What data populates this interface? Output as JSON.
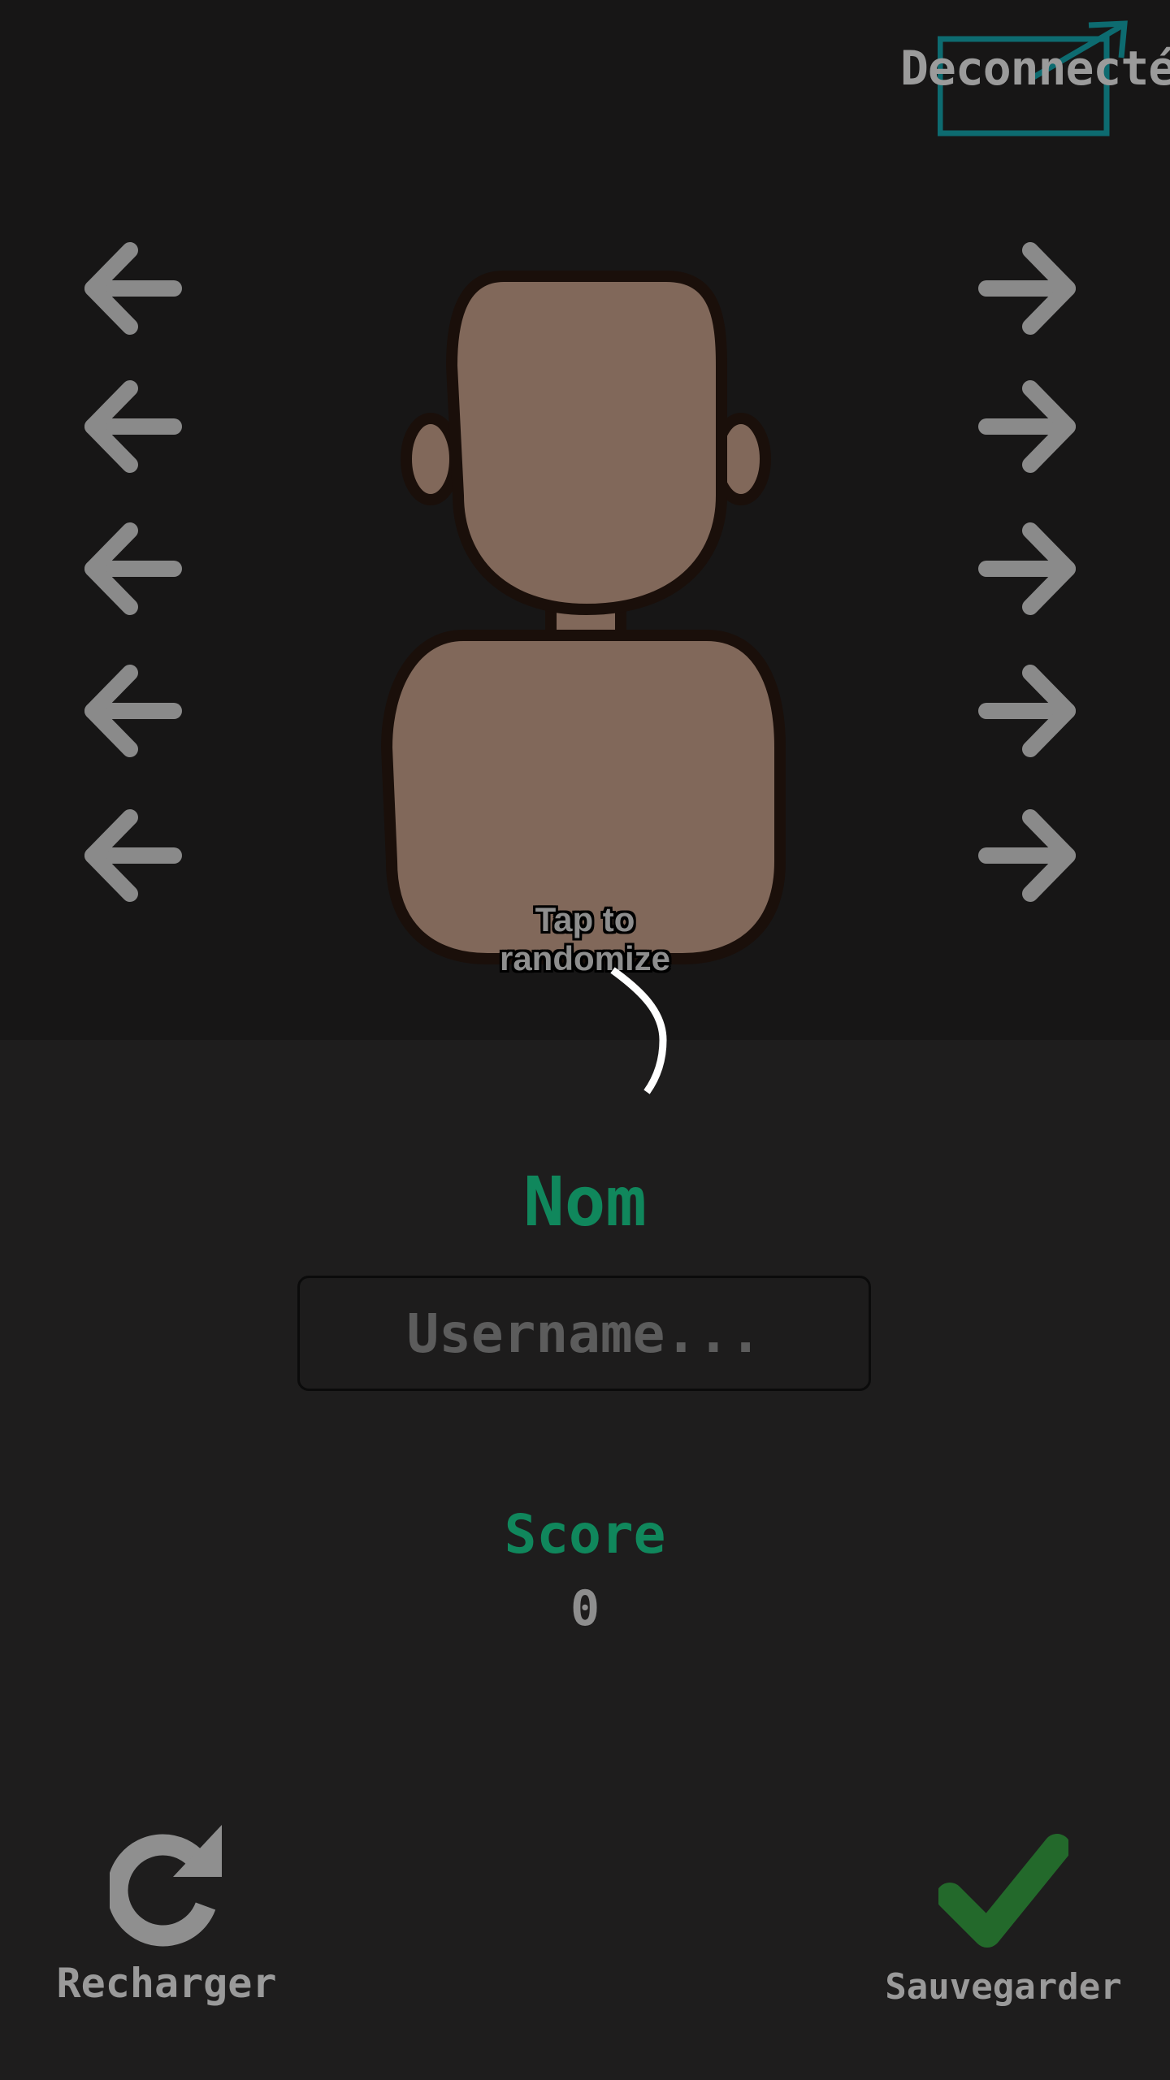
{
  "header": {
    "logout_label": "Deconnecté"
  },
  "avatar": {
    "hint": "Tap to randomize",
    "skin_color": "#81685a",
    "outline_color": "#1a0f0a"
  },
  "arrows": {
    "color": "#8a8a8a",
    "rows": 5
  },
  "profile": {
    "name_label": "Nom",
    "username_value": "",
    "username_placeholder": "Username...",
    "score_label": "Score",
    "score_value": "0"
  },
  "actions": {
    "reload_label": "Recharger",
    "save_label": "Sauvegarder"
  },
  "colors": {
    "accent_green": "#10875c",
    "save_check": "#23692b",
    "logout_icon": "#0d6b70",
    "top_bg": "#171616",
    "bottom_bg": "#1e1d1d"
  },
  "icons": {
    "logout": "external-link-icon",
    "left": "arrow-left-icon",
    "right": "arrow-right-icon",
    "reload": "reload-icon",
    "save": "check-icon"
  }
}
